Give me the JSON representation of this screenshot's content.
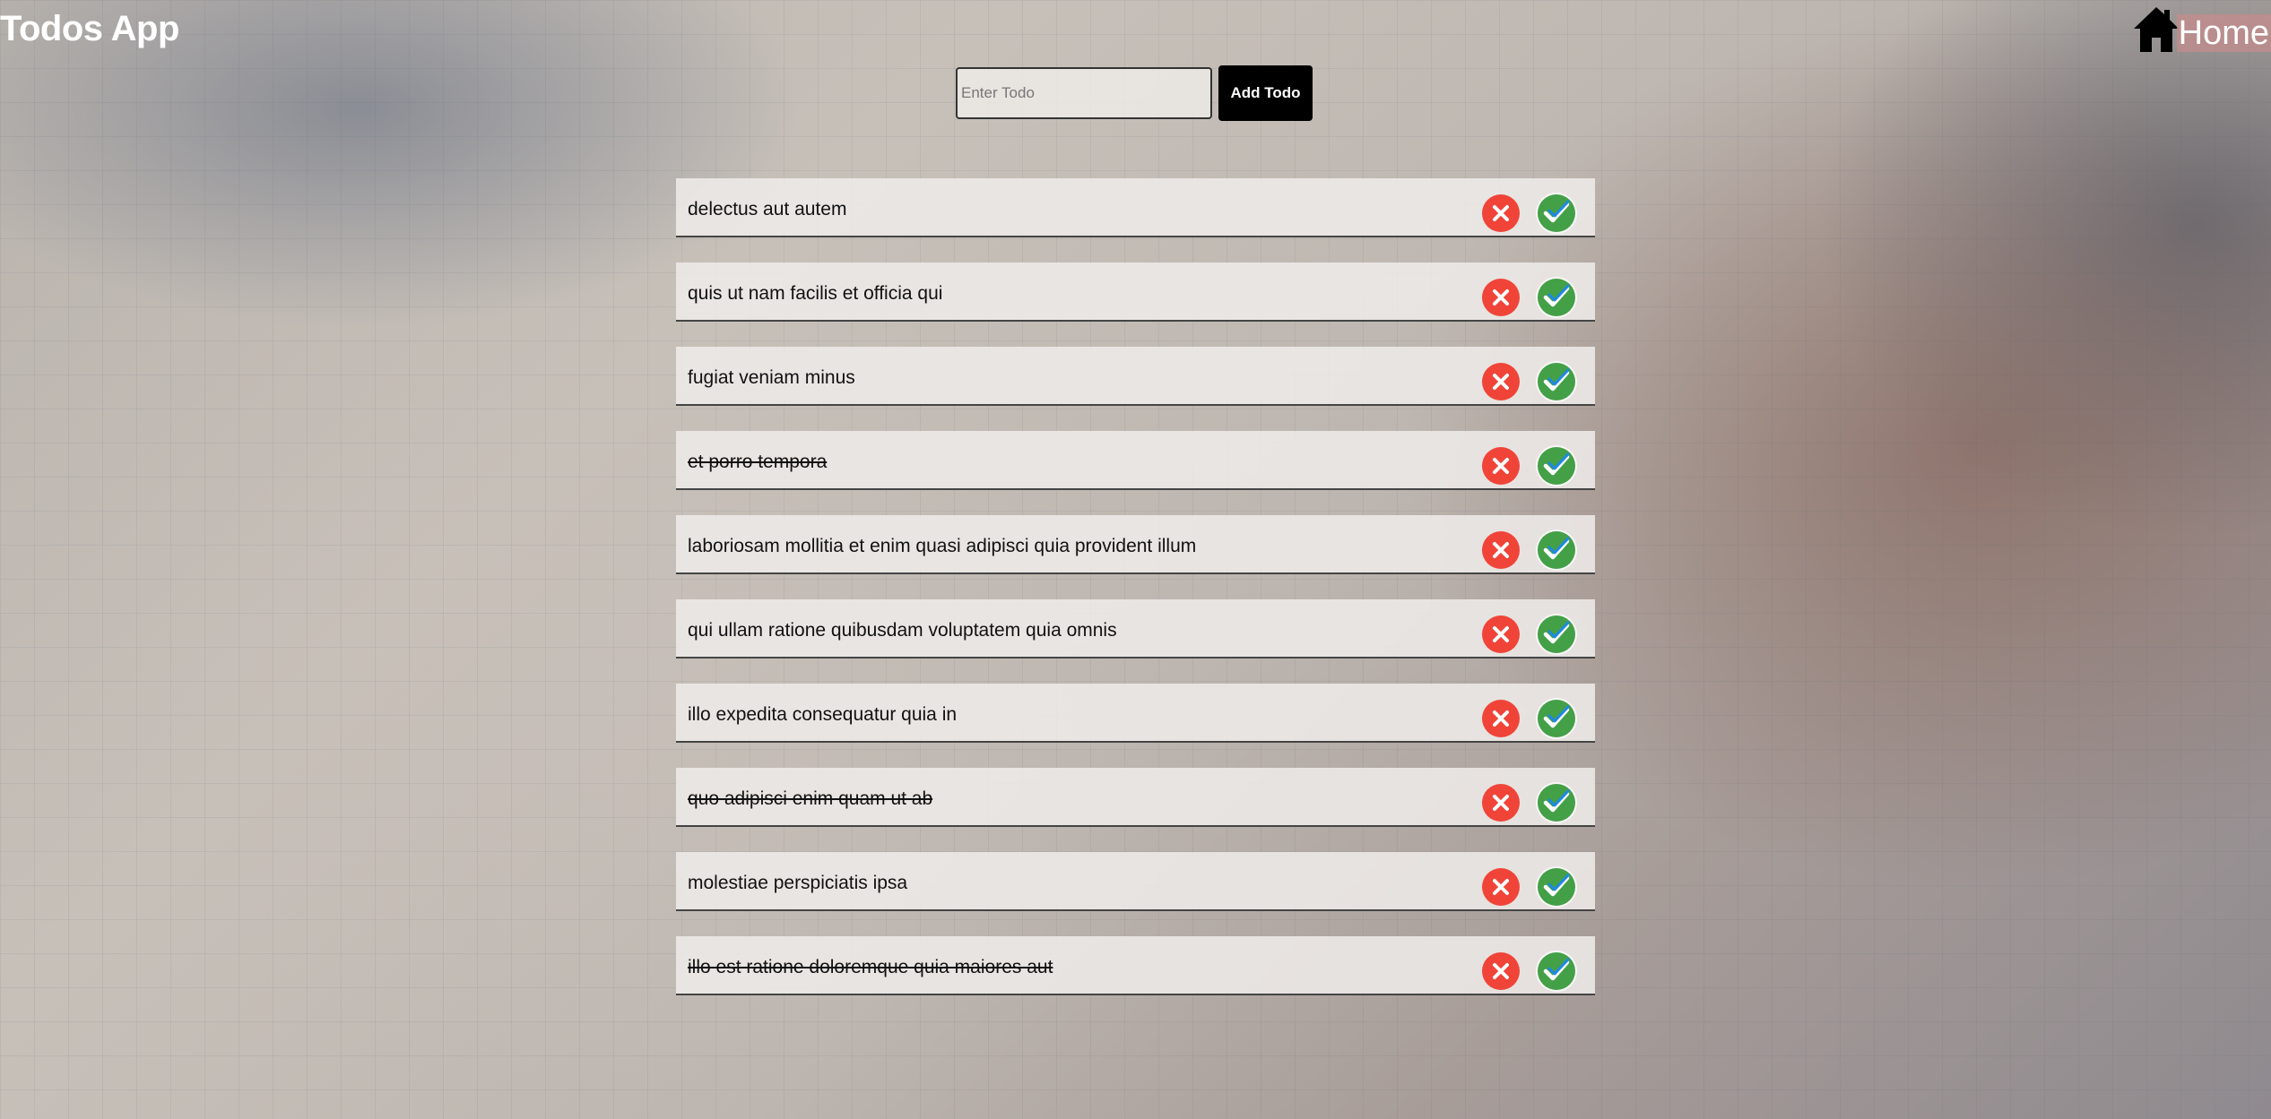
{
  "header": {
    "title": "Todos App",
    "home_label": "Home"
  },
  "form": {
    "placeholder": "Enter Todo",
    "value": "",
    "add_label": "Add Todo"
  },
  "colors": {
    "delete": "#f04438",
    "complete": "#43a047",
    "check_mark": "#1e88e5"
  },
  "todos": [
    {
      "text": "delectus aut autem",
      "completed": false
    },
    {
      "text": "quis ut nam facilis et officia qui",
      "completed": false
    },
    {
      "text": "fugiat veniam minus",
      "completed": false
    },
    {
      "text": "et porro tempora",
      "completed": true
    },
    {
      "text": "laboriosam mollitia et enim quasi adipisci quia provident illum",
      "completed": false
    },
    {
      "text": "qui ullam ratione quibusdam voluptatem quia omnis",
      "completed": false
    },
    {
      "text": "illo expedita consequatur quia in",
      "completed": false
    },
    {
      "text": "quo adipisci enim quam ut ab",
      "completed": true
    },
    {
      "text": "molestiae perspiciatis ipsa",
      "completed": false
    },
    {
      "text": "illo est ratione doloremque quia maiores aut",
      "completed": true
    }
  ],
  "icons": {
    "home": "home-icon",
    "delete": "close-icon",
    "complete": "check-double-icon"
  }
}
